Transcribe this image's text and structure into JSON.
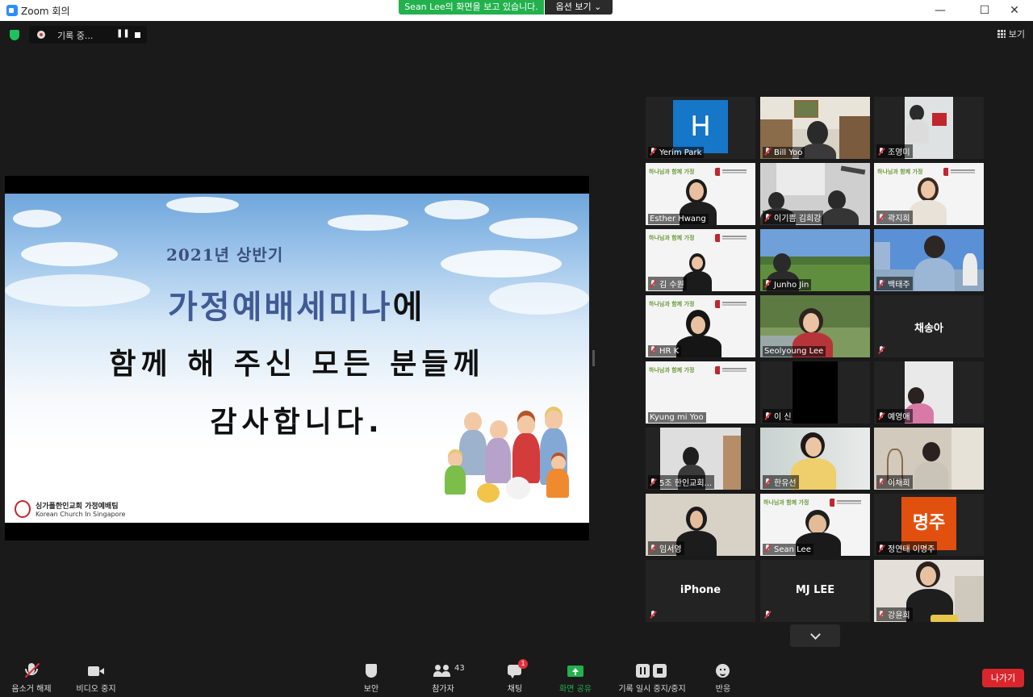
{
  "window": {
    "title": "Zoom 회의"
  },
  "share_banner": {
    "text": "Sean Lee의 화면을 보고 있습니다.",
    "options_label": "옵션 보기"
  },
  "recording": {
    "label": "기록 중..."
  },
  "view": {
    "label": "보기"
  },
  "slide": {
    "year": "2021년 상반기",
    "title_main": "가정예배세미나",
    "title_suffix": "에",
    "line2": "함께 해 주신 모든 분들께",
    "line3": "감사합니다.",
    "logo_line1": "싱가폴한인교회 가정예배팀",
    "logo_line2": "Korean Church In Singapore"
  },
  "participants": [
    {
      "name": "Yerim Park"
    },
    {
      "name": "Bill Yoo"
    },
    {
      "name": "조영미"
    },
    {
      "name": "Esther Hwang"
    },
    {
      "name": "이기쁨 김희강"
    },
    {
      "name": "곽지희"
    },
    {
      "name": "김 수원"
    },
    {
      "name": "Junho Jin"
    },
    {
      "name": "백태주"
    },
    {
      "name": "HR K"
    },
    {
      "name": "Seolyoung Lee"
    },
    {
      "name": "채송아",
      "center": "채송아"
    },
    {
      "name": "Kyung mi Yoo"
    },
    {
      "name": "이 신"
    },
    {
      "name": "예영애"
    },
    {
      "name": "5조 한인교회..."
    },
    {
      "name": "한유선"
    },
    {
      "name": "이채희"
    },
    {
      "name": "임서영"
    },
    {
      "name": "Sean Lee"
    },
    {
      "name": "정연태 이명주"
    },
    {
      "name": "iPhone",
      "center": "iPhone"
    },
    {
      "name": "MJ LEE",
      "center": "MJ LEE"
    },
    {
      "name": "강윤희"
    }
  ],
  "avatars": {
    "yerim": "H",
    "myeongju": "명주"
  },
  "toolbar": {
    "unmute": "음소거 해제",
    "stop_video": "비디오 중지",
    "security": "보안",
    "participants": "참가자",
    "participants_count": "43",
    "chat": "채팅",
    "chat_badge": "1",
    "share": "화면 공유",
    "pause_rec": "기록 일시 중지/중지",
    "reactions": "반응",
    "leave": "나가기"
  },
  "colors": {
    "active_speaker": "#c8e63a",
    "share_green": "#22b14c",
    "leave_red": "#d9262d"
  }
}
